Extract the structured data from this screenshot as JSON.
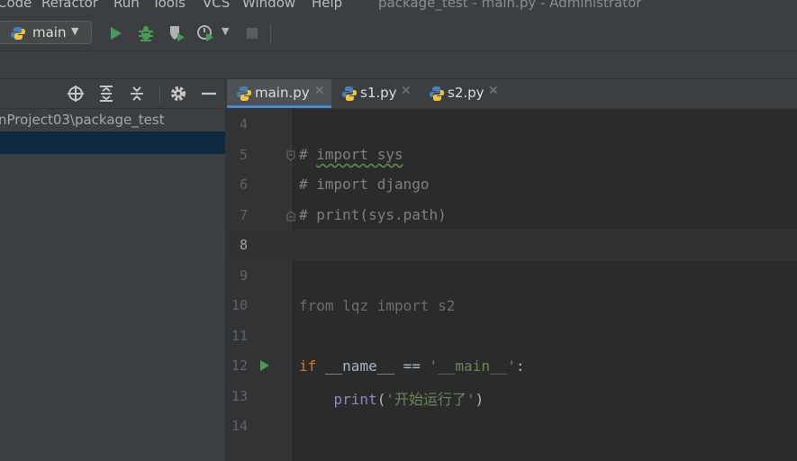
{
  "menu": {
    "items": [
      "Code",
      "Refactor",
      "Run",
      "Tools",
      "VCS",
      "Window",
      "Help"
    ],
    "window_title": "package_test - main.py - Administrator"
  },
  "toolbar": {
    "run_config": "main",
    "icons": [
      "run-icon",
      "debug-icon",
      "run-with-coverage-icon",
      "profile-icon",
      "more-run-options-icon",
      "stop-icon"
    ]
  },
  "project": {
    "path": "nProject03\\package_test",
    "header_icons": [
      "locate-icon",
      "expand-all-icon",
      "collapse-all-icon",
      "settings-icon",
      "hide-icon"
    ]
  },
  "tabs": [
    {
      "name": "main.py",
      "active": true
    },
    {
      "name": "s1.py",
      "active": false
    },
    {
      "name": "s2.py",
      "active": false
    }
  ],
  "editor": {
    "current_line": 8,
    "lines": [
      {
        "no": "4",
        "text": ""
      },
      {
        "no": "5",
        "text": "# import sys"
      },
      {
        "no": "6",
        "text": "# import django"
      },
      {
        "no": "7",
        "text": "# print(sys.path)"
      },
      {
        "no": "8",
        "text": ""
      },
      {
        "no": "9",
        "text": ""
      },
      {
        "no": "10",
        "text": "from lqz import s2"
      },
      {
        "no": "11",
        "text": ""
      },
      {
        "no": "12",
        "text": "if __name__ == '__main__':"
      },
      {
        "no": "13",
        "text": "    print('开始运行了')"
      },
      {
        "no": "14",
        "text": ""
      }
    ]
  },
  "colors": {
    "comment": "#808080",
    "keyword": "#cc7832",
    "string": "#6a8759",
    "builtin": "#8888c6",
    "run_green": "#499c54"
  }
}
